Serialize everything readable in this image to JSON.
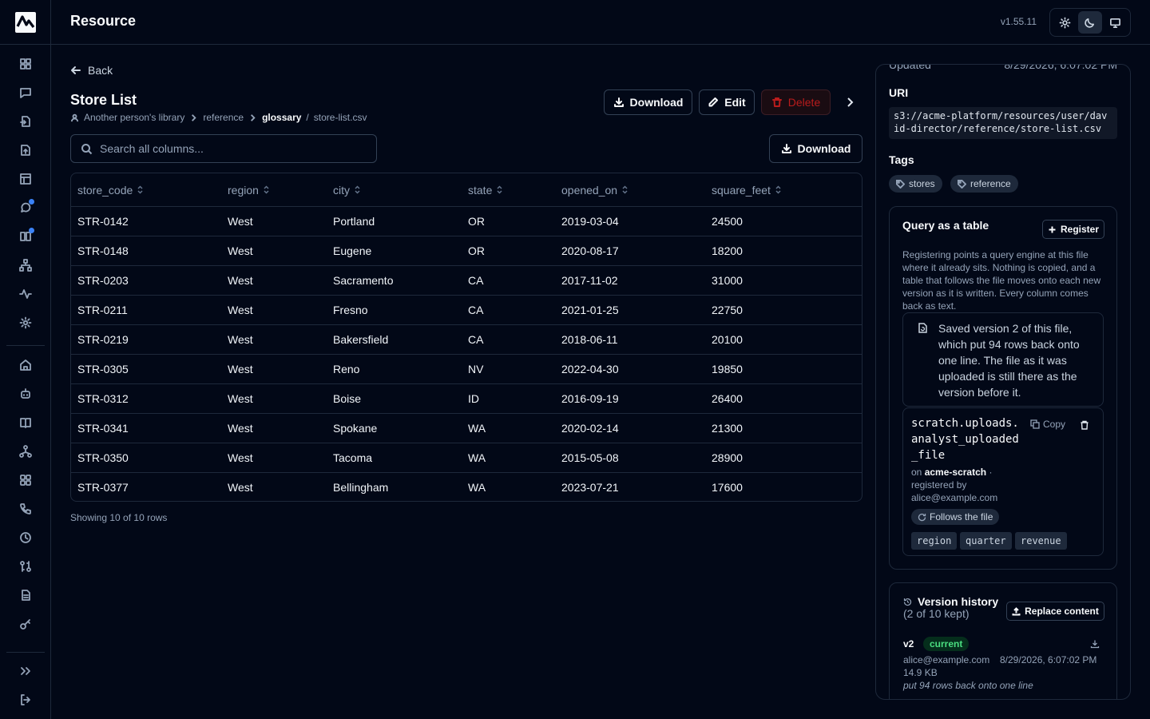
{
  "app": {
    "title": "Resource",
    "version": "v1.55.11"
  },
  "theme": {
    "options": [
      "light-icon",
      "dark-icon",
      "system-icon"
    ],
    "active": "dark"
  },
  "rail": {
    "top_icons": [
      "grid-icon",
      "chat-icon",
      "file-import-icon",
      "file-upload-icon",
      "table-icon",
      "chat-bubble-icon",
      "book-open-icon",
      "hierarchy-icon",
      "activity-icon",
      "gear-icon"
    ],
    "bottom_icons": [
      "home-icon",
      "bot-icon",
      "book-icon",
      "network-icon",
      "apps-icon",
      "phone-icon",
      "clock-icon",
      "git-compare-icon",
      "document-icon",
      "key-icon"
    ],
    "footer_icons": [
      "expand-icon",
      "logout-icon"
    ]
  },
  "nav": {
    "back_label": "Back"
  },
  "page": {
    "title": "Store List",
    "breadcrumb": {
      "library": "Another person's library",
      "folder": "reference",
      "current": "glossary",
      "file": "store-list.csv"
    }
  },
  "actions": {
    "download": "Download",
    "edit": "Edit",
    "delete": "Delete"
  },
  "search": {
    "placeholder": "Search all columns...",
    "download": "Download"
  },
  "table": {
    "columns": [
      "store_code",
      "region",
      "city",
      "state",
      "opened_on",
      "square_feet"
    ],
    "rows": [
      [
        "STR-0142",
        "West",
        "Portland",
        "OR",
        "2019-03-04",
        "24500"
      ],
      [
        "STR-0148",
        "West",
        "Eugene",
        "OR",
        "2020-08-17",
        "18200"
      ],
      [
        "STR-0203",
        "West",
        "Sacramento",
        "CA",
        "2017-11-02",
        "31000"
      ],
      [
        "STR-0211",
        "West",
        "Fresno",
        "CA",
        "2021-01-25",
        "22750"
      ],
      [
        "STR-0219",
        "West",
        "Bakersfield",
        "CA",
        "2018-06-11",
        "20100"
      ],
      [
        "STR-0305",
        "West",
        "Reno",
        "NV",
        "2022-04-30",
        "19850"
      ],
      [
        "STR-0312",
        "West",
        "Boise",
        "ID",
        "2016-09-19",
        "26400"
      ],
      [
        "STR-0341",
        "West",
        "Spokane",
        "WA",
        "2020-02-14",
        "21300"
      ],
      [
        "STR-0350",
        "West",
        "Tacoma",
        "WA",
        "2015-05-08",
        "28900"
      ],
      [
        "STR-0377",
        "West",
        "Bellingham",
        "WA",
        "2023-07-21",
        "17600"
      ]
    ],
    "footer": "Showing 10 of 10 rows"
  },
  "details": {
    "updated_label": "Updated",
    "updated_value": "8/29/2026, 6:07:02 PM",
    "uri_label": "URI",
    "uri": "s3://acme-platform/resources/user/david-director/reference/store-list.csv",
    "tags_label": "Tags",
    "tags": [
      "stores",
      "reference"
    ]
  },
  "query": {
    "title": "Query as a table",
    "register": "Register",
    "description": "Registering points a query engine at this file where it already sits. Nothing is copied, and a table that follows the file moves onto each new version as it is written. Every column comes back as text.",
    "notice": "Saved version 2 of this file, which put 94 rows back onto one line. The file as it was uploaded is still there as the version before it.",
    "table_name": "scratch.uploads.analyst_uploaded_file",
    "copy": "Copy",
    "on_label": "on",
    "engine": "acme-scratch",
    "dot": "·",
    "registered_by": "registered by",
    "registered_email": "alice@example.com",
    "follows": "Follows the file",
    "columns": [
      "region",
      "quarter",
      "revenue"
    ]
  },
  "history": {
    "title": "Version history",
    "count": "(2 of 10 kept)",
    "replace": "Replace content",
    "version": "v2",
    "badge": "current",
    "author": "alice@example.com",
    "date": "8/29/2026, 6:07:02 PM",
    "size": "14.9 KB",
    "message": "put 94 rows back onto one line"
  }
}
